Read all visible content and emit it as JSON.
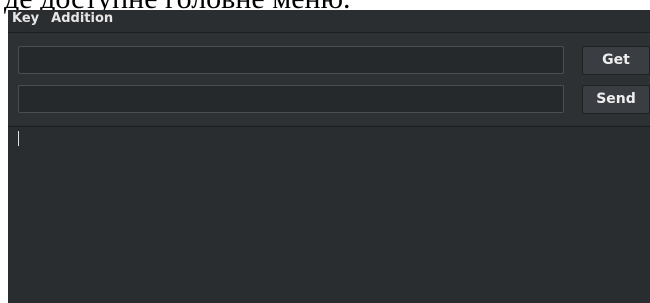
{
  "caption": {
    "text": "де доступне головне меню."
  },
  "menubar": {
    "items": [
      {
        "label": "Key"
      },
      {
        "label": "Addition"
      }
    ]
  },
  "toolbar": {
    "get_label": "Get",
    "send_label": "Send",
    "input_1_value": "",
    "input_2_value": ""
  },
  "output": {
    "text": ""
  },
  "colors": {
    "window_bg": "#2b2e31",
    "input_bg": "#26292c",
    "button_bg": "#3a3d41",
    "text": "#e6e6e6"
  }
}
